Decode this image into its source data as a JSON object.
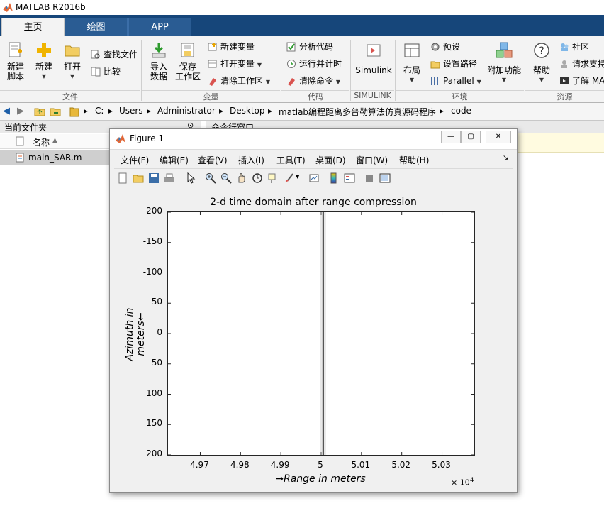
{
  "app": {
    "title": "MATLAB R2016b"
  },
  "tabs": [
    {
      "label": "主页"
    },
    {
      "label": "绘图"
    },
    {
      "label": "APP"
    }
  ],
  "ribbon": {
    "file_group": {
      "new_script": "新建\n脚本",
      "new": "新建",
      "open": "打开",
      "find_files": "查找文件",
      "compare": "比较",
      "label": "文件"
    },
    "variable_group": {
      "import": "导入\n数据",
      "save_workspace": "保存\n工作区",
      "new_variable": "新建变量",
      "open_variable": "打开变量",
      "clear_workspace": "清除工作区",
      "label": "变量"
    },
    "code_group": {
      "analyze": "分析代码",
      "run_time": "运行并计时",
      "clear_commands": "清除命令",
      "label": "代码"
    },
    "simulink_group": {
      "simulink": "Simulink",
      "label": "SIMULINK"
    },
    "env_group": {
      "layout": "布局",
      "prefs": "预设",
      "set_path": "设置路径",
      "parallel": "Parallel",
      "addons": "附加功能",
      "label": "环境"
    },
    "resources_group": {
      "help": "帮助",
      "community": "社区",
      "request": "请求支持",
      "learn": "了解 MA",
      "label": "资源"
    }
  },
  "address": {
    "crumbs": [
      "C:",
      "Users",
      "Administrator",
      "Desktop",
      "matlab编程距离多普勒算法仿真源码程序",
      "code"
    ]
  },
  "current_folder": {
    "title": "当前文件夹",
    "column_name": "名称",
    "files": [
      "main_SAR.m"
    ]
  },
  "command_window": {
    "title": "命令行窗口"
  },
  "figure": {
    "title": "Figure 1",
    "menus": [
      "文件(F)",
      "编辑(E)",
      "查看(V)",
      "插入(I)",
      "工具(T)",
      "桌面(D)",
      "窗口(W)",
      "帮助(H)"
    ]
  },
  "chart_data": {
    "type": "line",
    "title": "2-d time domain after range compression",
    "xlabel": "→Range in meters",
    "ylabel": "Azimuth in meters←",
    "x_exponent_label": "× 10",
    "x_exponent": "4",
    "xlim": [
      49620,
      50380
    ],
    "ylim": [
      200,
      -200
    ],
    "y_reversed": true,
    "xticks": [
      49700,
      49800,
      49900,
      50000,
      50100,
      50200,
      50300
    ],
    "xtick_labels": [
      "4.97",
      "4.98",
      "4.99",
      "5",
      "5.01",
      "5.02",
      "5.03"
    ],
    "yticks": [
      -200,
      -150,
      -100,
      -50,
      0,
      50,
      100,
      150,
      200
    ],
    "ytick_labels": [
      "-200",
      "-150",
      "-100",
      "-50",
      "0",
      "50",
      "100",
      "150",
      "200"
    ],
    "grid": false,
    "series": [
      {
        "x": [
          50005,
          50005
        ],
        "y": [
          -200,
          200
        ],
        "color": "#3a3a3a"
      }
    ]
  }
}
